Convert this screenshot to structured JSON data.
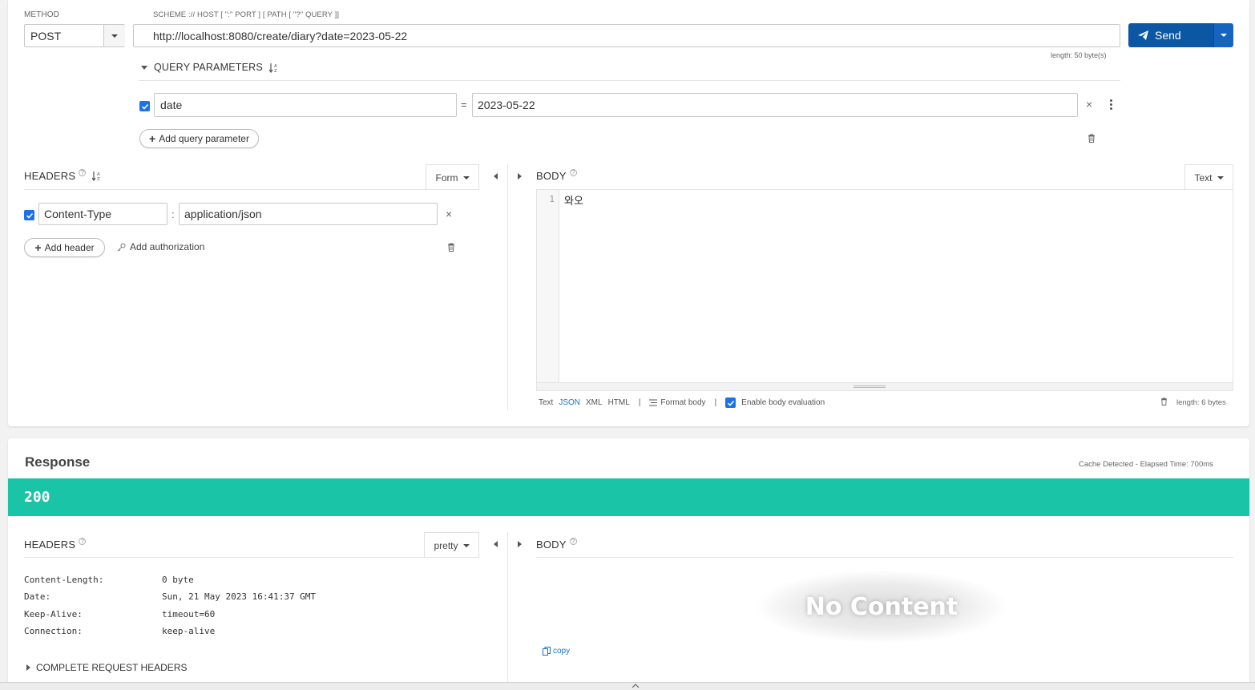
{
  "request": {
    "method_label": "METHOD",
    "method_value": "POST",
    "url_label": "SCHEME :// HOST [ \":\" PORT ] [ PATH [ \"?\" QUERY ]]",
    "url_value": "http://localhost:8080/create/diary?date=2023-05-22",
    "url_length": "length: 50 byte(s)",
    "send_label": "Send",
    "query": {
      "title": "QUERY PARAMETERS",
      "params": [
        {
          "checked": true,
          "name": "date",
          "value": "2023-05-22"
        }
      ],
      "equals": "=",
      "add_label": "Add query parameter"
    },
    "headers": {
      "title": "HEADERS",
      "mode": "Form",
      "items": [
        {
          "checked": true,
          "name": "Content-Type",
          "value": "application/json"
        }
      ],
      "separator": ":",
      "add_header_label": "Add header",
      "add_auth_label": "Add authorization"
    },
    "body": {
      "title": "BODY",
      "mode": "Text",
      "line_number": "1",
      "content": "와오",
      "formats": [
        "Text",
        "JSON",
        "XML",
        "HTML"
      ],
      "active_format": "JSON",
      "separator": "|",
      "format_body_label": "Format body",
      "eval_label": "Enable body evaluation",
      "eval_checked": true,
      "length": "length: 6 bytes"
    }
  },
  "response": {
    "title": "Response",
    "meta": "Cache Detected - Elapsed Time: 700ms",
    "status": "200",
    "status_color": "#1ac4a6",
    "headers": {
      "title": "HEADERS",
      "mode": "pretty",
      "items": [
        {
          "name": "Content-Length:",
          "value": "0 byte"
        },
        {
          "name": "Date:",
          "value": "Sun, 21 May 2023 16:41:37 GMT"
        },
        {
          "name": "Keep-Alive:",
          "value": "timeout=60"
        },
        {
          "name": "Connection:",
          "value": "keep-alive"
        }
      ],
      "complete_label": "COMPLETE REQUEST HEADERS"
    },
    "body": {
      "title": "BODY",
      "no_content": "No Content",
      "copy_label": "copy"
    }
  },
  "colors": {
    "accent": "#0b57a4",
    "checkbox": "#1a73e8",
    "status_ok": "#1ac4a6"
  }
}
